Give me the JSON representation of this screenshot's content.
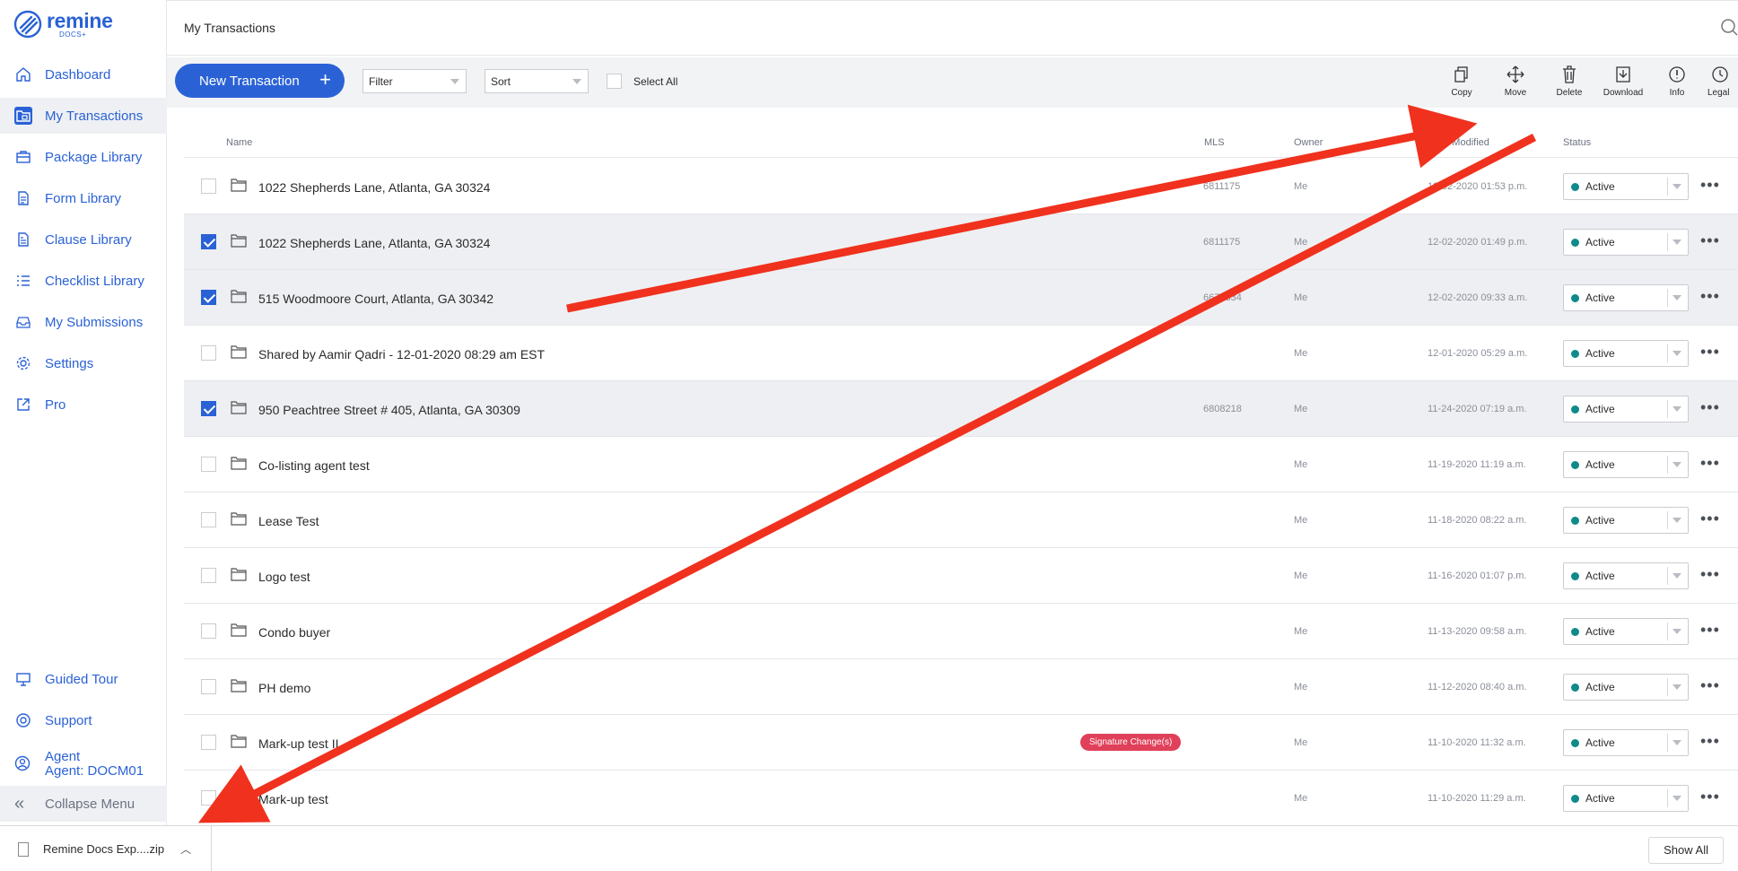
{
  "brand": {
    "name": "remine",
    "sub": "DOCS+"
  },
  "sidebar": {
    "items": [
      {
        "label": "Dashboard",
        "icon": "home-icon"
      },
      {
        "label": "My Transactions",
        "icon": "folder-icon"
      },
      {
        "label": "Package Library",
        "icon": "briefcase-icon"
      },
      {
        "label": "Form Library",
        "icon": "document-icon"
      },
      {
        "label": "Clause Library",
        "icon": "clause-icon"
      },
      {
        "label": "Checklist Library",
        "icon": "checklist-icon"
      },
      {
        "label": "My Submissions",
        "icon": "inbox-icon"
      },
      {
        "label": "Settings",
        "icon": "gear-icon"
      },
      {
        "label": "Pro",
        "icon": "external-link-icon"
      }
    ],
    "bottom": [
      {
        "label": "Guided Tour",
        "icon": "tour-icon"
      },
      {
        "label": "Support",
        "icon": "support-icon"
      }
    ],
    "agent": {
      "line1": "Agent",
      "line2": "Agent: DOCM01"
    },
    "collapse_label": "Collapse Menu"
  },
  "header": {
    "title": "My Transactions"
  },
  "toolbar": {
    "new_label": "New Transaction",
    "filter_label": "Filter",
    "sort_label": "Sort",
    "select_all_label": "Select All",
    "tools": [
      "Copy",
      "Move",
      "Delete",
      "Download",
      "Info",
      "Legal"
    ]
  },
  "table": {
    "headers": {
      "name": "Name",
      "mls": "MLS",
      "owner": "Owner",
      "date": "Date Modified",
      "status": "Status"
    },
    "rows": [
      {
        "name": "1022 Shepherds Lane, Atlanta, GA 30324",
        "mls": "6811175",
        "owner": "Me",
        "date": "12-02-2020 01:53 p.m.",
        "status": "Active",
        "checked": false,
        "badge": ""
      },
      {
        "name": "1022 Shepherds Lane, Atlanta, GA 30324",
        "mls": "6811175",
        "owner": "Me",
        "date": "12-02-2020 01:49 p.m.",
        "status": "Active",
        "checked": true,
        "badge": ""
      },
      {
        "name": "515 Woodmoore Court, Atlanta, GA 30342",
        "mls": "6677334",
        "owner": "Me",
        "date": "12-02-2020 09:33 a.m.",
        "status": "Active",
        "checked": true,
        "badge": ""
      },
      {
        "name": "Shared by Aamir Qadri - 12-01-2020 08:29 am EST",
        "mls": "",
        "owner": "Me",
        "date": "12-01-2020 05:29 a.m.",
        "status": "Active",
        "checked": false,
        "badge": ""
      },
      {
        "name": "950 Peachtree Street # 405, Atlanta, GA 30309",
        "mls": "6808218",
        "owner": "Me",
        "date": "11-24-2020 07:19 a.m.",
        "status": "Active",
        "checked": true,
        "badge": ""
      },
      {
        "name": "Co-listing agent test",
        "mls": "",
        "owner": "Me",
        "date": "11-19-2020 11:19 a.m.",
        "status": "Active",
        "checked": false,
        "badge": ""
      },
      {
        "name": "Lease Test",
        "mls": "",
        "owner": "Me",
        "date": "11-18-2020 08:22 a.m.",
        "status": "Active",
        "checked": false,
        "badge": ""
      },
      {
        "name": "Logo test",
        "mls": "",
        "owner": "Me",
        "date": "11-16-2020 01:07 p.m.",
        "status": "Active",
        "checked": false,
        "badge": ""
      },
      {
        "name": "Condo buyer",
        "mls": "",
        "owner": "Me",
        "date": "11-13-2020 09:58 a.m.",
        "status": "Active",
        "checked": false,
        "badge": ""
      },
      {
        "name": "PH demo",
        "mls": "",
        "owner": "Me",
        "date": "11-12-2020 08:40 a.m.",
        "status": "Active",
        "checked": false,
        "badge": ""
      },
      {
        "name": "Mark-up test II",
        "mls": "",
        "owner": "Me",
        "date": "11-10-2020 11:32 a.m.",
        "status": "Active",
        "checked": false,
        "badge": "Signature Change(s)"
      },
      {
        "name": "Mark-up test",
        "mls": "",
        "owner": "Me",
        "date": "11-10-2020 11:29 a.m.",
        "status": "Active",
        "checked": false,
        "badge": ""
      }
    ]
  },
  "download_bar": {
    "file": "Remine Docs Exp....zip",
    "show_all": "Show All"
  },
  "colors": {
    "accent": "#2a62d6",
    "status_dot": "#0f8a8a",
    "badge": "#e0405a",
    "arrow": "#f0311e"
  }
}
